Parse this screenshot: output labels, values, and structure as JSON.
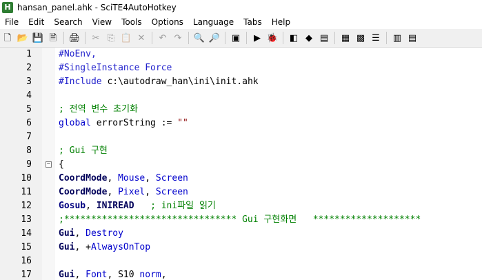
{
  "window": {
    "title": "hansan_panel.ahk - SciTE4AutoHotkey",
    "app_icon_glyph": "H"
  },
  "menu": [
    "File",
    "Edit",
    "Search",
    "View",
    "Tools",
    "Options",
    "Language",
    "Tabs",
    "Help"
  ],
  "toolbar": {
    "icons": [
      {
        "name": "new-file-icon",
        "glyph": "🗋"
      },
      {
        "name": "open-folder-icon",
        "glyph": "📂"
      },
      {
        "name": "save-icon",
        "glyph": "💾"
      },
      {
        "name": "close-file-icon",
        "glyph": "🗎"
      },
      {
        "name": "sep"
      },
      {
        "name": "print-icon",
        "glyph": "🖨"
      },
      {
        "name": "sep"
      },
      {
        "name": "cut-icon",
        "glyph": "✂",
        "disabled": true
      },
      {
        "name": "copy-icon",
        "glyph": "⎘",
        "disabled": true
      },
      {
        "name": "paste-icon",
        "glyph": "📋",
        "disabled": true
      },
      {
        "name": "delete-icon",
        "glyph": "✕",
        "disabled": true
      },
      {
        "name": "sep"
      },
      {
        "name": "undo-icon",
        "glyph": "↶",
        "disabled": true
      },
      {
        "name": "redo-icon",
        "glyph": "↷",
        "disabled": true
      },
      {
        "name": "sep"
      },
      {
        "name": "find-icon",
        "glyph": "🔍"
      },
      {
        "name": "replace-icon",
        "glyph": "🔎"
      },
      {
        "name": "sep"
      },
      {
        "name": "script-icon",
        "glyph": "▣"
      },
      {
        "name": "sep"
      },
      {
        "name": "run-icon",
        "glyph": "▶"
      },
      {
        "name": "debug-icon",
        "glyph": "🐞"
      },
      {
        "name": "sep"
      },
      {
        "name": "window-spy-icon",
        "glyph": "◧"
      },
      {
        "name": "cube-icon",
        "glyph": "◆"
      },
      {
        "name": "settings-icon",
        "glyph": "▤"
      },
      {
        "name": "sep"
      },
      {
        "name": "notes-icon",
        "glyph": "▦"
      },
      {
        "name": "gallery-icon",
        "glyph": "▩"
      },
      {
        "name": "list-icon",
        "glyph": "☰"
      },
      {
        "name": "sep"
      },
      {
        "name": "doc-icon",
        "glyph": "▥"
      },
      {
        "name": "doc2-icon",
        "glyph": "▤"
      }
    ]
  },
  "colors": {
    "directive": "#2222cc",
    "comment": "#008000",
    "command": "#00005a",
    "string": "#8b0000",
    "gutter": "#f1f1f1"
  },
  "lines": [
    {
      "n": "1",
      "tokens": [
        {
          "t": "#NoEnv,",
          "c": "directive"
        }
      ]
    },
    {
      "n": "2",
      "tokens": [
        {
          "t": "#SingleInstance Force",
          "c": "directive"
        }
      ]
    },
    {
      "n": "3",
      "tokens": [
        {
          "t": "#Include ",
          "c": "directive"
        },
        {
          "t": "c:\\autodraw_han\\ini\\init.ahk",
          "c": "plain"
        }
      ]
    },
    {
      "n": "4",
      "tokens": []
    },
    {
      "n": "5",
      "tokens": [
        {
          "t": "; 전역 변수 초기화",
          "c": "comment"
        }
      ]
    },
    {
      "n": "6",
      "tokens": [
        {
          "t": "global",
          "c": "kw-blue"
        },
        {
          "t": " errorString := ",
          "c": "plain"
        },
        {
          "t": "\"\"",
          "c": "str"
        }
      ]
    },
    {
      "n": "7",
      "tokens": []
    },
    {
      "n": "8",
      "tokens": [
        {
          "t": "; Gui 구현",
          "c": "comment"
        }
      ]
    },
    {
      "n": "9",
      "fold": "−",
      "tokens": [
        {
          "t": "{",
          "c": "plain"
        }
      ]
    },
    {
      "n": "10",
      "tokens": [
        {
          "t": "CoordMode",
          "c": "kw-bold"
        },
        {
          "t": ", ",
          "c": "plain"
        },
        {
          "t": "Mouse",
          "c": "kw-blue"
        },
        {
          "t": ", ",
          "c": "plain"
        },
        {
          "t": "Screen",
          "c": "kw-blue"
        }
      ]
    },
    {
      "n": "11",
      "tokens": [
        {
          "t": "CoordMode",
          "c": "kw-bold"
        },
        {
          "t": ", ",
          "c": "plain"
        },
        {
          "t": "Pixel",
          "c": "kw-blue"
        },
        {
          "t": ", ",
          "c": "plain"
        },
        {
          "t": "Screen",
          "c": "kw-blue"
        }
      ]
    },
    {
      "n": "12",
      "tokens": [
        {
          "t": "Gosub",
          "c": "kw-cmd"
        },
        {
          "t": ", ",
          "c": "plain"
        },
        {
          "t": "INIREAD",
          "c": "kw-bold"
        },
        {
          "t": "   ",
          "c": "plain"
        },
        {
          "t": "; ini파일 읽기",
          "c": "comment"
        }
      ]
    },
    {
      "n": "13",
      "tokens": [
        {
          "t": ";******************************** Gui 구현화면   ********************",
          "c": "comment"
        }
      ]
    },
    {
      "n": "14",
      "tokens": [
        {
          "t": "Gui",
          "c": "kw-bold"
        },
        {
          "t": ", ",
          "c": "plain"
        },
        {
          "t": "Destroy",
          "c": "kw-blue"
        }
      ]
    },
    {
      "n": "15",
      "tokens": [
        {
          "t": "Gui",
          "c": "kw-bold"
        },
        {
          "t": ", +",
          "c": "plain"
        },
        {
          "t": "AlwaysOnTop",
          "c": "kw-blue"
        }
      ]
    },
    {
      "n": "16",
      "tokens": []
    },
    {
      "n": "17",
      "tokens": [
        {
          "t": "Gui",
          "c": "kw-bold"
        },
        {
          "t": ", ",
          "c": "plain"
        },
        {
          "t": "Font",
          "c": "kw-blue"
        },
        {
          "t": ", S10 ",
          "c": "plain"
        },
        {
          "t": "norm",
          "c": "kw-blue"
        },
        {
          "t": ",",
          "c": "plain"
        }
      ]
    }
  ]
}
